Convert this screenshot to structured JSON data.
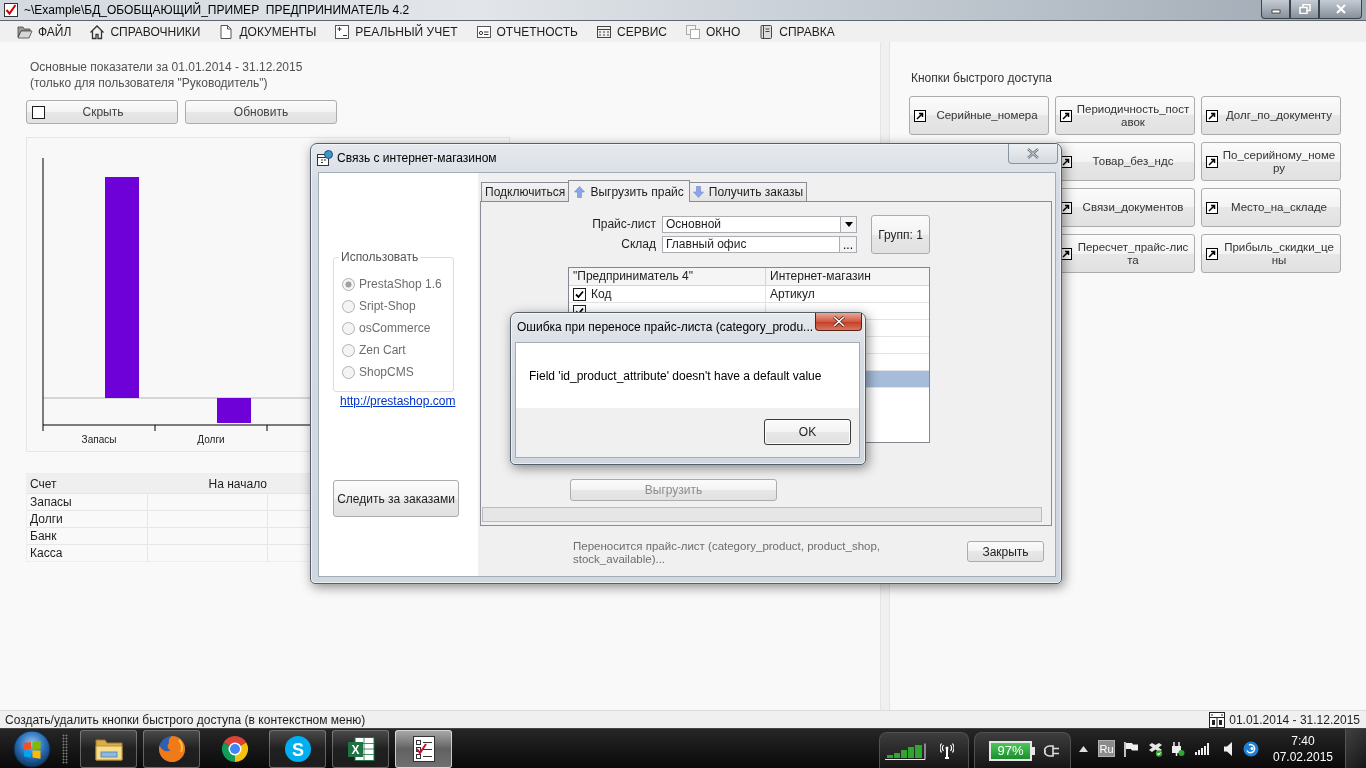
{
  "window": {
    "title": "~\\Example\\БД_ОБОБЩАЮЩИЙ_ПРИМЕР  ПРЕДПРИНИМАТЕЛЬ 4.2"
  },
  "menu": [
    {
      "label": "ФАЙЛ"
    },
    {
      "label": "СПРАВОЧНИКИ"
    },
    {
      "label": "ДОКУМЕНТЫ"
    },
    {
      "label": "РЕАЛЬНЫЙ УЧЕТ"
    },
    {
      "label": "ОТЧЕТНОСТЬ"
    },
    {
      "label": "СЕРВИС"
    },
    {
      "label": "ОКНО"
    },
    {
      "label": "СПРАВКА"
    }
  ],
  "summary": {
    "heading": "Основные показатели за 01.01.2014 - 31.12.2015",
    "note": "(только для пользователя \"Руководитель\")",
    "hide_toggle": {
      "label": "Скрыть",
      "checked": false
    },
    "refresh_button": {
      "label": "Обновить"
    }
  },
  "chart": {
    "categories": [
      "Запасы",
      "Долги"
    ]
  },
  "accounts_table": {
    "columns": [
      "Счет",
      "На начало"
    ],
    "rows": [
      {
        "account": "Запасы"
      },
      {
        "account": "Долги"
      },
      {
        "account": "Банк"
      },
      {
        "account": "Касса"
      }
    ]
  },
  "quick_access": {
    "title": "Кнопки быстрого доступа",
    "rows": [
      {
        "buttons": [
          "Серийные_номера",
          "Периодичность_поставок",
          "Долг_по_документу"
        ]
      },
      {
        "buttons": [
          "Товар_без_ндс",
          "По_серийному_номеру"
        ]
      },
      {
        "buttons": [
          "Связи_документов",
          "Место_на_складе"
        ]
      },
      {
        "buttons": [
          "Пересчет_прайс-листа",
          "Прибыль_скидки_цены"
        ]
      }
    ]
  },
  "status_bar": {
    "hint": "Создать/удалить кнопки быстрого доступа (в контекстном меню)",
    "period": "01.01.2014 - 31.12.2015"
  },
  "shop_dialog": {
    "title": "Связь с интернет-магазином",
    "platform_group": {
      "title": "Использовать",
      "disabled": true,
      "options": [
        {
          "label": "PrestaShop 1.6",
          "selected": true
        },
        {
          "label": "Sript-Shop",
          "selected": false
        },
        {
          "label": "osCommerce",
          "selected": false
        },
        {
          "label": "Zen Cart",
          "selected": false
        },
        {
          "label": "ShopCMS",
          "selected": false
        }
      ]
    },
    "link": "http://prestashop.com",
    "track_button": "Следить за заказами",
    "tabs": [
      {
        "label": "Подключиться",
        "selected": false
      },
      {
        "label": "Выгрузить прайс",
        "selected": true
      },
      {
        "label": "Получить заказы",
        "selected": false
      }
    ],
    "price_list": {
      "label": "Прайс-лист",
      "value": "Основной"
    },
    "warehouse": {
      "label": "Склад",
      "value": "Главный офис",
      "browse": "..."
    },
    "groups_button": "Групп: 1",
    "mapping": {
      "columns": [
        "\"Предприниматель 4\"",
        "Интернет-магазин"
      ],
      "rows": [
        {
          "checked": true,
          "source": "Код",
          "target": "Артикул",
          "selected": false
        },
        {
          "checked": true,
          "selected": false
        },
        {
          "selected": false
        },
        {
          "selected": false
        },
        {
          "selected": false
        },
        {
          "selected": true
        }
      ]
    },
    "upload_button": {
      "label": "Выгрузить",
      "disabled": true
    },
    "progress": {
      "level": 0
    },
    "status": "Переносится прайс-лист (category_product, product_shop, stock_available)...",
    "close_button": "Закрыть"
  },
  "error_dialog": {
    "title": "Ошибка при переносе прайс-листа (category_produ...",
    "message": "Field 'id_product_attribute' doesn't have a default value",
    "ok_button": "OK"
  },
  "taskbar": {
    "apps": [
      {
        "kind": "folder",
        "running": true,
        "selected": false
      },
      {
        "kind": "fox-globe",
        "running": true,
        "selected": false
      },
      {
        "kind": "wheel",
        "running": false,
        "selected": false
      },
      {
        "kind": "chat",
        "running": true,
        "selected": false,
        "glyph": "S"
      },
      {
        "kind": "spreadsheet",
        "running": true,
        "selected": false,
        "glyph": "X"
      },
      {
        "kind": "checklist",
        "running": true,
        "selected": true
      }
    ],
    "battery": "97%",
    "language": "Ru",
    "time": "7:40",
    "date": "07.02.2015"
  }
}
